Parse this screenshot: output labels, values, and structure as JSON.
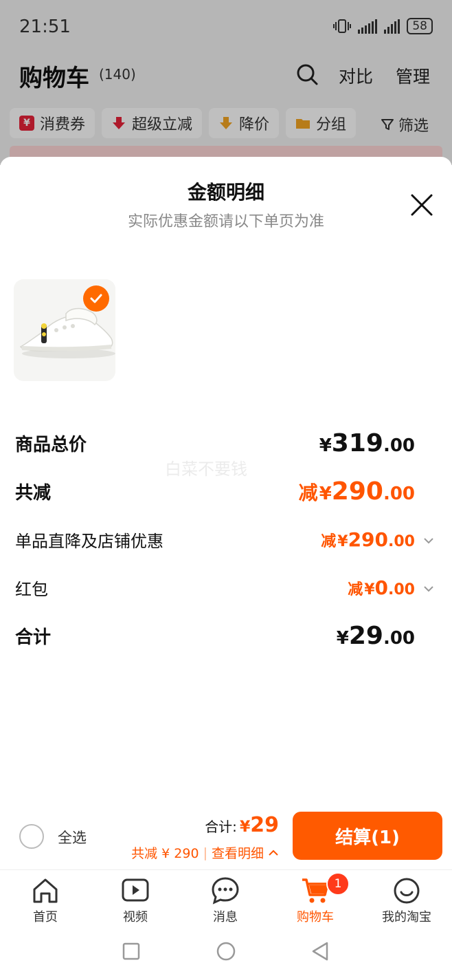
{
  "status": {
    "time": "21:51",
    "battery": "58"
  },
  "header": {
    "title": "购物车",
    "count": "(140)",
    "compare": "对比",
    "manage": "管理"
  },
  "filters": [
    {
      "label": "消费券",
      "color": "#e8233a",
      "icon": "coupon-icon"
    },
    {
      "label": "超级立减",
      "color": "#e8233a",
      "icon": "arrow-down-icon"
    },
    {
      "label": "降价",
      "color": "#f5a623",
      "icon": "price-drop-icon"
    },
    {
      "label": "分组",
      "color": "#f5a623",
      "icon": "folder-icon"
    }
  ],
  "filter_button": "筛选",
  "sheet": {
    "title": "金额明细",
    "subtitle": "实际优惠金额请以下单页为准",
    "watermark": "白菜不要钱"
  },
  "rows": {
    "subtotal": {
      "label": "商品总价",
      "yen": "¥",
      "int": "319",
      "dec": ".00"
    },
    "discount": {
      "label": "共减",
      "prefix": "减",
      "yen": "¥",
      "int": "290",
      "dec": ".00"
    },
    "store": {
      "label": "单品直降及店铺优惠",
      "prefix": "减",
      "yen": "¥",
      "int": "290",
      "dec": ".00"
    },
    "redpacket": {
      "label": "红包",
      "prefix": "减",
      "yen": "¥",
      "int": "0",
      "dec": ".00"
    },
    "total": {
      "label": "合计",
      "yen": "¥",
      "int": "29",
      "dec": ".00"
    }
  },
  "bottom": {
    "select_all": "全选",
    "total_label": "合计:",
    "total_yen": "¥",
    "total_value": "29",
    "saving": "共减 ¥ 290",
    "detail": "查看明细",
    "checkout": "结算(1)"
  },
  "tabs": [
    {
      "label": "首页",
      "icon": "home-icon"
    },
    {
      "label": "视频",
      "icon": "video-icon"
    },
    {
      "label": "消息",
      "icon": "message-icon"
    },
    {
      "label": "购物车",
      "icon": "cart-icon",
      "badge": "1",
      "active": true
    },
    {
      "label": "我的淘宝",
      "icon": "profile-icon"
    }
  ],
  "accent_color": "#ff5500"
}
